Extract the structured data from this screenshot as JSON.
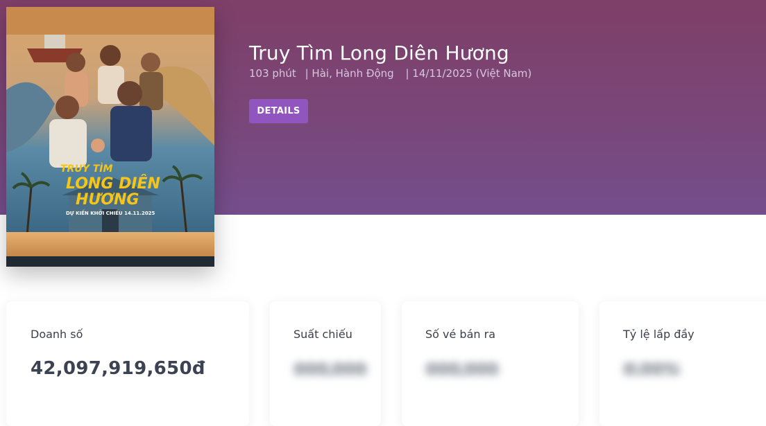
{
  "movie": {
    "title": "Truy Tìm Long Diên Hương",
    "duration": "103 phút",
    "genres": "| Hài, Hành Động",
    "release": "| 14/11/2025 (Việt Nam)",
    "details_label": "DETAILS"
  },
  "poster": {
    "title_line1": "TRUY TÌM",
    "title_line2": "LONG DIÊN",
    "title_line3": "HƯƠNG",
    "release_text": "DỰ KIẾN KHỞI CHIẾU 14.11.2025"
  },
  "stats": [
    {
      "label": "Doanh số",
      "value": "42,097,919,650đ"
    },
    {
      "label": "Suất chiếu",
      "value": "000,000"
    },
    {
      "label": "Số vé bán ra",
      "value": "000,000"
    },
    {
      "label": "Tỷ lệ lấp đầy",
      "value": "0.00%"
    }
  ],
  "colors": {
    "hero_top": "#7e3f68",
    "hero_bottom": "#744e8c",
    "accent_button": "#9155bf",
    "poster_title": "#f5c518"
  }
}
